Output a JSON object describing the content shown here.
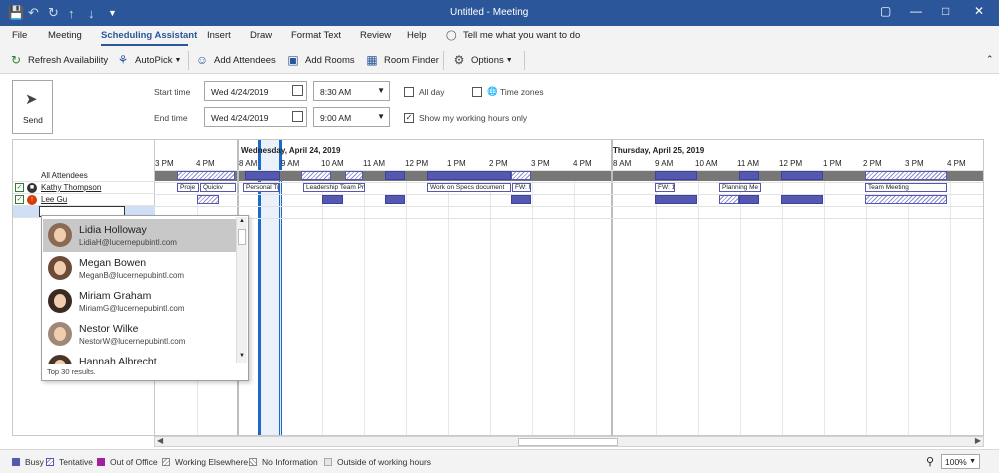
{
  "window": {
    "title": "Untitled  -  Meeting",
    "controls": [
      "restore-icon",
      "minimize-icon",
      "maximize-icon",
      "close-icon"
    ]
  },
  "quick_access": [
    "save-icon",
    "undo-icon",
    "redo-icon",
    "up-icon",
    "down-icon",
    "customize-icon"
  ],
  "menu": {
    "items": [
      "File",
      "Meeting",
      "Scheduling Assistant",
      "Insert",
      "Draw",
      "Format Text",
      "Review",
      "Help"
    ],
    "active": "Scheduling Assistant",
    "tell_me": "Tell me what you want to do"
  },
  "ribbon": {
    "refresh": "Refresh Availability",
    "autopick": "AutoPick",
    "add_attendees": "Add Attendees",
    "add_rooms": "Add Rooms",
    "room_finder": "Room Finder",
    "options": "Options"
  },
  "form": {
    "send": "Send",
    "start_label": "Start time",
    "end_label": "End time",
    "start_date": "Wed 4/24/2019",
    "start_time": "8:30 AM",
    "end_date": "Wed 4/24/2019",
    "end_time": "9:00 AM",
    "all_day": "All day",
    "all_day_checked": false,
    "time_zones": "Time zones",
    "time_zones_checked": false,
    "working_hours": "Show my working hours only",
    "working_hours_checked": true
  },
  "attendees": {
    "header": "All Attendees",
    "rows": [
      {
        "name": "Kathy Thompson",
        "checked": true,
        "role": "organizer"
      },
      {
        "name": "Lee Gu",
        "checked": true,
        "role": "required"
      }
    ],
    "new_row_value": ""
  },
  "timeline": {
    "days": [
      "Wednesday, April 24, 2019",
      "Thursday, April 25, 2019"
    ],
    "hours_day0": [
      "3 PM",
      "4 PM",
      "8 AM",
      "9 AM",
      "10 AM",
      "11 AM",
      "12 PM",
      "1 PM",
      "2 PM",
      "3 PM",
      "4 PM"
    ],
    "hours_day1": [
      "8 AM",
      "9 AM",
      "10 AM",
      "11 AM",
      "12 PM",
      "1 PM",
      "2 PM",
      "3 PM",
      "4 PM"
    ],
    "meeting_labels": [
      "Proje",
      "Quickv",
      "Personal Tra",
      "Leadership Team Pr",
      "Work on Specs document",
      "FW: N",
      "FW: 1",
      "Planning Me",
      "Team Meeting"
    ]
  },
  "suggestions": {
    "people": [
      {
        "name": "Lidia Holloway",
        "email": "LidiaH@lucernepubintl.com"
      },
      {
        "name": "Megan Bowen",
        "email": "MeganB@lucernepubintl.com"
      },
      {
        "name": "Miriam Graham",
        "email": "MiriamG@lucernepubintl.com"
      },
      {
        "name": "Nestor Wilke",
        "email": "NestorW@lucernepubintl.com"
      },
      {
        "name": "Hannah Albrecht",
        "email": ""
      }
    ],
    "footer": "Top 30 results."
  },
  "legend": {
    "busy": "Busy",
    "tentative": "Tentative",
    "out_of_office": "Out of Office",
    "working_elsewhere": "Working Elsewhere",
    "no_information": "No Information",
    "outside_hours": "Outside of working hours",
    "busy_color": "#5558af",
    "ooo_color": "#a0229e"
  },
  "zoom": "100%"
}
